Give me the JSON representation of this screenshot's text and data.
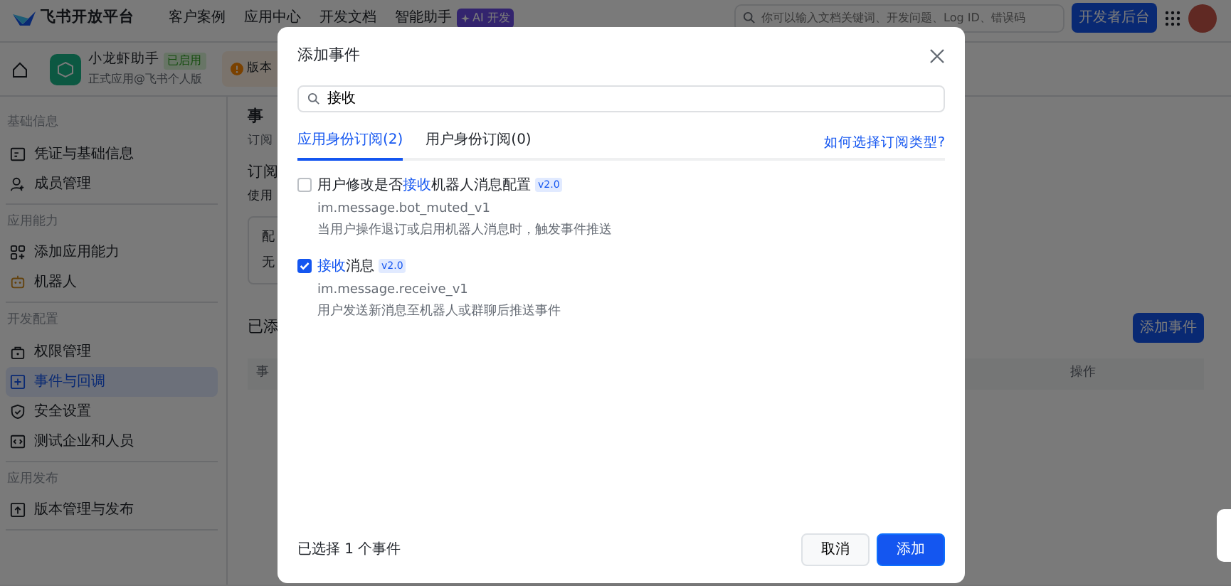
{
  "nav": {
    "logo": "飞书开放平台",
    "links": [
      "客户案例",
      "应用中心",
      "开发文档",
      "智能助手"
    ],
    "ai_badge": "AI 开发",
    "search": {
      "placeholder": "你可以输入文档关键词、开发问题、Log ID、错误码"
    },
    "console_button": "开发者后台"
  },
  "app": {
    "name": "小龙虾助手",
    "status": "已启用",
    "edition": "正式应用@飞书个人版",
    "notice": "版本"
  },
  "sidebar": {
    "sections": [
      {
        "title": "基础信息",
        "items": [
          {
            "label": "凭证与基础信息",
            "selected": false
          },
          {
            "label": "成员管理",
            "selected": false
          }
        ]
      },
      {
        "title": "应用能力",
        "items": [
          {
            "label": "添加应用能力",
            "selected": false
          },
          {
            "label": "机器人",
            "selected": false
          }
        ]
      },
      {
        "title": "开发配置",
        "items": [
          {
            "label": "权限管理",
            "selected": false
          },
          {
            "label": "事件与回调",
            "selected": true
          },
          {
            "label": "安全设置",
            "selected": false
          },
          {
            "label": "测试企业和人员",
            "selected": false
          }
        ]
      },
      {
        "title": "应用发布",
        "items": [
          {
            "label": "版本管理与发布",
            "selected": false
          }
        ]
      }
    ]
  },
  "content": {
    "title": "事",
    "subtitle": "订阅",
    "section_title": "订阅",
    "section_text": "使用",
    "config_lines": [
      "配",
      "无"
    ],
    "added_title": "已添",
    "add_button": "添加事件",
    "table_columns": [
      "事",
      "操作"
    ]
  },
  "dialog": {
    "title": "添加事件",
    "search": {
      "value": "接收"
    },
    "tabs": [
      {
        "label": "应用身份订阅(2)",
        "selected": true
      },
      {
        "label": "用户身份订阅(0)",
        "selected": false
      }
    ],
    "help_link": "如何选择订阅类型?",
    "events": [
      {
        "checked": false,
        "title": [
          {
            "text": "用户修改是否",
            "match": false
          },
          {
            "text": "接收",
            "match": true
          },
          {
            "text": "机器人消息配置",
            "match": false
          }
        ],
        "version": "v2.0",
        "code": "im.message.bot_muted_v1",
        "description": "当用户操作退订或启用机器人消息时，触发事件推送"
      },
      {
        "checked": true,
        "title": [
          {
            "text": "接收",
            "match": true
          },
          {
            "text": "消息",
            "match": false
          }
        ],
        "version": "v2.0",
        "code": "im.message.receive_v1",
        "description": "用户发送新消息至机器人或群聊后推送事件"
      }
    ],
    "selected_count": "已选择 1 个事件",
    "cancel_button": "取消",
    "confirm_button": "添加"
  }
}
